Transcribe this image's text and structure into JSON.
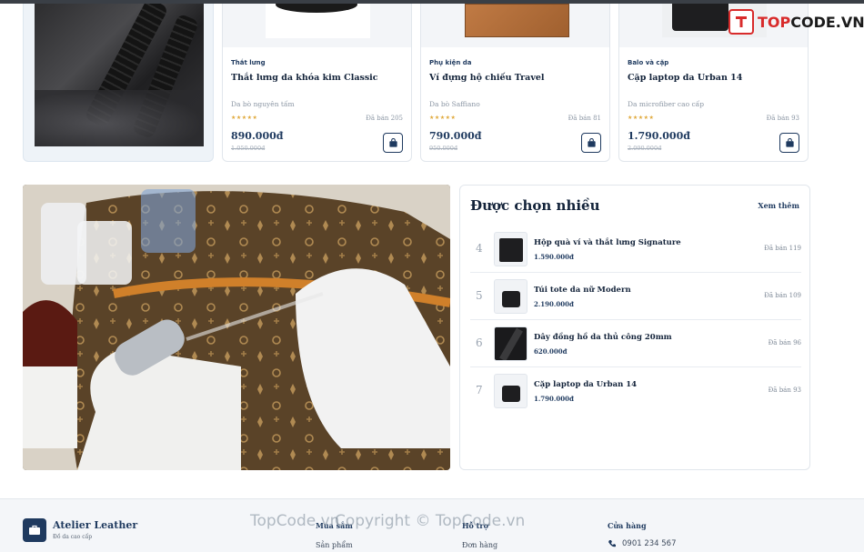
{
  "watermark": {
    "brand_prefix": "TOP",
    "brand_suffix": "CODE.VN",
    "footer_left": "TopCode.vn",
    "footer_center": "Copyright © TopCode.vn"
  },
  "products": [
    {
      "category": "Thắt lưng",
      "name": "Thắt lưng da khóa kim Classic",
      "material": "Da bò nguyên tấm",
      "stars": "★★★★★",
      "sold": "Đã bán 205",
      "price": "890.000đ",
      "old_price": "1.050.000đ"
    },
    {
      "category": "Phụ kiện da",
      "name": "Ví đựng hộ chiếu Travel",
      "material": "Da bò Saffiano",
      "stars": "★★★★★",
      "sold": "Đã bán 81",
      "price": "790.000đ",
      "old_price": "950.000đ"
    },
    {
      "category": "Balo và cặp",
      "name": "Cặp laptop da Urban 14",
      "material": "Da microfiber cao cấp",
      "stars": "★★★★★",
      "sold": "Đã bán 93",
      "price": "1.790.000đ",
      "old_price": "2.090.000đ"
    }
  ],
  "popular": {
    "title": "Được chọn nhiều",
    "more": "Xem thêm",
    "items": [
      {
        "rank": "4",
        "name": "Hộp quà ví và thắt lưng Signature",
        "price": "1.590.000đ",
        "sold": "Đã bán 119"
      },
      {
        "rank": "5",
        "name": "Túi tote da nữ Modern",
        "price": "2.190.000đ",
        "sold": "Đã bán 109"
      },
      {
        "rank": "6",
        "name": "Dây đồng hồ da thủ công 20mm",
        "price": "620.000đ",
        "sold": "Đã bán 96"
      },
      {
        "rank": "7",
        "name": "Cặp laptop da Urban 14",
        "price": "1.790.000đ",
        "sold": "Đã bán 93"
      }
    ]
  },
  "footer": {
    "brand": "Atelier Leather",
    "tagline": "Đồ da cao cấp",
    "col1_title": "Mua sắm",
    "col1_link": "Sản phẩm",
    "col2_title": "Hỗ trợ",
    "col2_link": "Đơn hàng",
    "col3_title": "Cửa hàng",
    "phone": "0901 234 567"
  },
  "colors": {
    "primary": "#1f3a5f",
    "star": "#e0a93b",
    "brand_red": "#d82b2b"
  }
}
